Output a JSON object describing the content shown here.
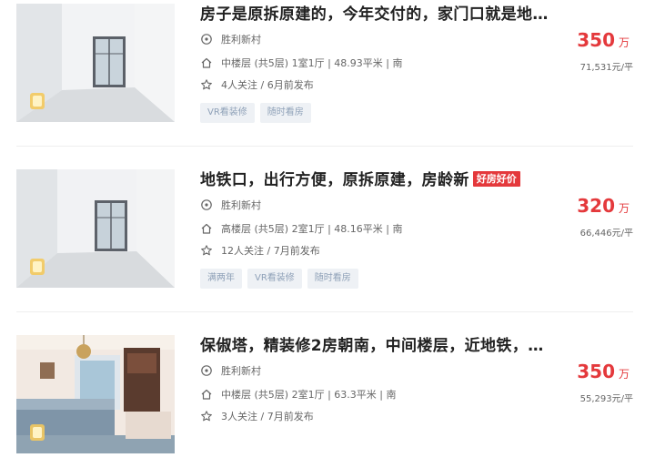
{
  "listings": [
    {
      "title": "房子是原拆原建的，今年交付的，家门口就是地…",
      "hot_tag": "",
      "community": "胜利新村",
      "info": "中楼层 (共5层) 1室1厅 | 48.93平米 | 南",
      "follow": "4人关注 / 6月前发布",
      "tags": [
        "VR看装修",
        "随时看房"
      ],
      "price": "350",
      "price_unit": "万",
      "unit_price": "71,531元/平"
    },
    {
      "title": "地铁口，出行方便，原拆原建，房龄新",
      "hot_tag": "好房好价",
      "community": "胜利新村",
      "info": "高楼层 (共5层) 2室1厅 | 48.16平米 | 南",
      "follow": "12人关注 / 7月前发布",
      "tags": [
        "满两年",
        "VR看装修",
        "随时看房"
      ],
      "price": "320",
      "price_unit": "万",
      "unit_price": "66,446元/平"
    },
    {
      "title": "保俶塔，精装修2房朝南，中间楼层，近地铁，…",
      "hot_tag": "",
      "community": "胜利新村",
      "info": "中楼层 (共5层) 2室1厅 | 63.3平米 | 南",
      "follow": "3人关注 / 7月前发布",
      "tags": [],
      "price": "350",
      "price_unit": "万",
      "unit_price": "55,293元/平"
    }
  ],
  "colors": {
    "price": "#e4393c",
    "tag_bg": "#eef1f5",
    "tag_text": "#8fa1b8"
  },
  "icons": {
    "community": "location-pin-icon",
    "info": "house-icon",
    "follow": "star-icon"
  }
}
